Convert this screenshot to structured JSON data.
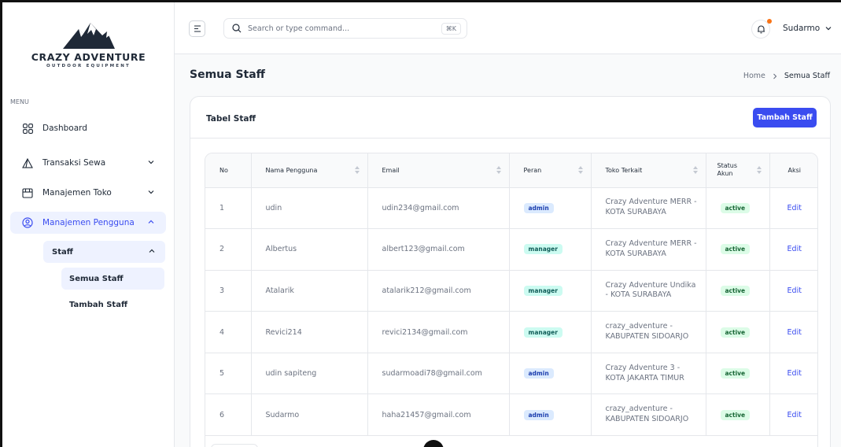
{
  "brand": {
    "title": "CRAZY ADVENTURE",
    "subtitle": "OUTDOOR EQUIPMENT"
  },
  "sidebar": {
    "menu_label": "MENU",
    "items": [
      {
        "label": "Dashboard",
        "icon": "grid-icon"
      },
      {
        "label": "Transaksi Sewa",
        "icon": "tent-icon"
      },
      {
        "label": "Manajemen Toko",
        "icon": "store-icon"
      },
      {
        "label": "Manajemen Pengguna",
        "icon": "user-circle-icon"
      }
    ],
    "sub_parent": "Staff",
    "sub_items": [
      "Semua Staff",
      "Tambah Staff"
    ]
  },
  "header": {
    "search_placeholder": "Search or type command...",
    "shortcut": "⌘K",
    "user_name": "Sudarmo"
  },
  "page": {
    "title": "Semua Staff",
    "breadcrumb": [
      "Home",
      "Semua Staff"
    ]
  },
  "card": {
    "title": "Tabel Staff",
    "add_button": "Tambah Staff"
  },
  "table": {
    "columns": {
      "no": "No",
      "nama": "Nama Pengguna",
      "email": "Email",
      "peran": "Peran",
      "toko": "Toko Terkait",
      "status_1": "Status",
      "status_2": "Akun",
      "aksi": "Aksi"
    },
    "rows": [
      {
        "no": "1",
        "nama": "udin",
        "email": "udin234@gmail.com",
        "peran": "admin",
        "toko": "Crazy Adventure MERR - KOTA SURABAYA",
        "status": "active",
        "aksi": "Edit"
      },
      {
        "no": "2",
        "nama": "Albertus",
        "email": "albert123@gmail.com",
        "peran": "manager",
        "toko": "Crazy Adventure MERR - KOTA SURABAYA",
        "status": "active",
        "aksi": "Edit"
      },
      {
        "no": "3",
        "nama": "Atalarik",
        "email": "atalarik212@gmail.com",
        "peran": "manager",
        "toko": "Crazy Adventure Undika - KOTA SURABAYA",
        "status": "active",
        "aksi": "Edit"
      },
      {
        "no": "4",
        "nama": "Revici214",
        "email": "revici2134@gmail.com",
        "peran": "manager",
        "toko": "crazy_adventure - KABUPATEN SIDOARJO",
        "status": "active",
        "aksi": "Edit"
      },
      {
        "no": "5",
        "nama": "udin sapiteng",
        "email": "sudarmoadi78@gmail.com",
        "peran": "admin",
        "toko": "Crazy Adventure 3 - KOTA JAKARTA TIMUR",
        "status": "active",
        "aksi": "Edit"
      },
      {
        "no": "6",
        "nama": "Sudarmo",
        "email": "haha21457@gmail.com",
        "peran": "admin",
        "toko": "crazy_adventure - KABUPATEN SIDOARJO",
        "status": "active",
        "aksi": "Edit"
      }
    ]
  },
  "colors": {
    "accent": "#3a4cf0",
    "admin_bg": "#dbeafe",
    "manager_bg": "#ccfbf1",
    "active_bg": "#dcfce7"
  }
}
